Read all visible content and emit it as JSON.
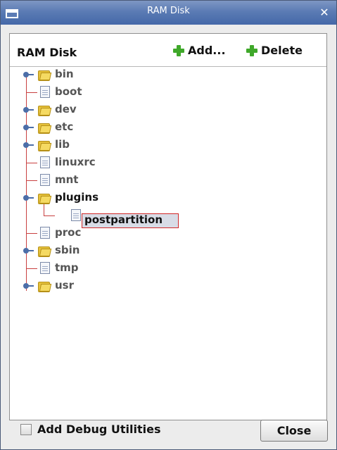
{
  "window": {
    "title": "RAM Disk",
    "close_icon": "close-icon"
  },
  "panel": {
    "title": "RAM Disk",
    "add_label": "Add...",
    "delete_label": "Delete",
    "add_icon": "green-plus-icon",
    "delete_icon": "green-plus-icon"
  },
  "tree": {
    "items": [
      {
        "label": "bin",
        "type": "folder"
      },
      {
        "label": "boot",
        "type": "file"
      },
      {
        "label": "dev",
        "type": "folder"
      },
      {
        "label": "etc",
        "type": "folder"
      },
      {
        "label": "lib",
        "type": "folder"
      },
      {
        "label": "linuxrc",
        "type": "file"
      },
      {
        "label": "mnt",
        "type": "file"
      },
      {
        "label": "plugins",
        "type": "folder",
        "expanded": true
      },
      {
        "label": "postpartition",
        "type": "file",
        "selected": true,
        "child_of": "plugins"
      },
      {
        "label": "proc",
        "type": "file"
      },
      {
        "label": "sbin",
        "type": "folder"
      },
      {
        "label": "tmp",
        "type": "file"
      },
      {
        "label": "usr",
        "type": "folder"
      }
    ]
  },
  "footer": {
    "checkbox_label": "Add Debug Utilities",
    "checkbox_checked": false,
    "close_label": "Close"
  },
  "colors": {
    "titlebar": "#5b7bb4",
    "tree_line": "#c84040",
    "plus": "#3fa82a",
    "folder": "#e6c23c"
  }
}
